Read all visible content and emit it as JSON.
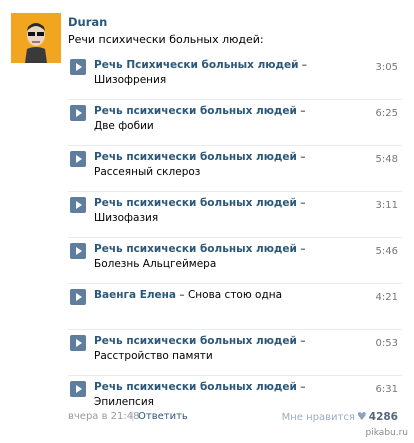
{
  "post": {
    "author": "Duran",
    "text": "Речи психически больных людей:"
  },
  "tracks": [
    {
      "artist": "Речь Психически больных людей",
      "title": "– Шизофрения",
      "duration": "3:05"
    },
    {
      "artist": "Речь психически больных людей",
      "title": "– Две фобии",
      "duration": "6:25"
    },
    {
      "artist": "Речь психически больных людей",
      "title": "– Рассеяный склероз",
      "duration": "5:48"
    },
    {
      "artist": "Речь психически больных людей",
      "title": "– Шизофазия",
      "duration": "3:11"
    },
    {
      "artist": "Речь психически больных людей",
      "title": "– Болезнь Альцгеймера",
      "duration": "5:46"
    },
    {
      "artist": "Ваенга Елена",
      "title": "– Снова стою одна",
      "duration": "4:21"
    },
    {
      "artist": "Речь психически больных людей",
      "title": "– Расстройство памяти",
      "duration": "0:53"
    },
    {
      "artist": "Речь психически больных людей",
      "title": "– Эпилепсия",
      "duration": "6:31"
    }
  ],
  "footer": {
    "time": "вчера в 21:48",
    "separator": "|",
    "reply": "Ответить",
    "like_label": "Мне нравится",
    "like_count": "4286"
  },
  "watermark": "pikabu.ru",
  "colors": {
    "link": "#2b587a",
    "play_button": "#5f7d9d",
    "avatar_bg": "#f0a020"
  }
}
